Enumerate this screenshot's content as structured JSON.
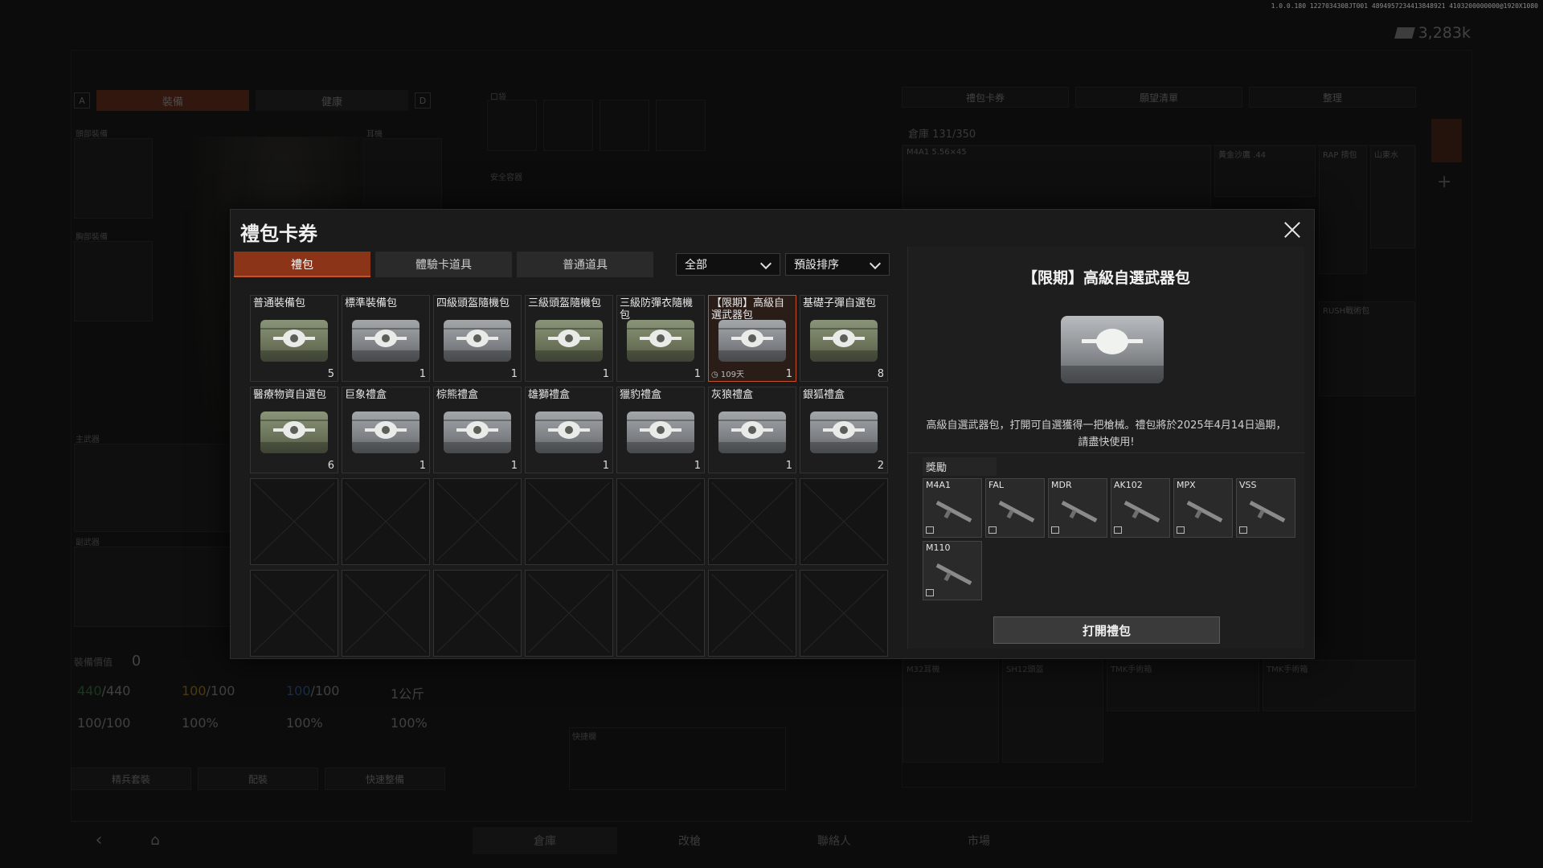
{
  "background": {
    "version": "1.0.0.180 1227034308JT001 4894957234413848921 4103200000000@1920X1080",
    "currency": "3,283k",
    "left_tabs": {
      "key_left": "A",
      "key_right": "D",
      "equip": "裝備",
      "health": "健康"
    },
    "slots": {
      "helmet": "頭部裝備",
      "headset": "耳機",
      "armor": "胸部裝備",
      "pockets": "口袋",
      "secure": "安全容器",
      "primary": "主武器",
      "secondary": "副武器"
    },
    "equip_value_label": "裝備價值",
    "equip_value": "0",
    "stats": {
      "hp": "440",
      "hp_max": "/440",
      "energy": "100",
      "energy_max": "/100",
      "water": "100",
      "water_max": "/100",
      "weight": "1公斤",
      "stamina": "100/100",
      "s2": "100%",
      "s3": "100%",
      "s4": "100%"
    },
    "left_buttons": [
      "精兵套裝",
      "配裝",
      "快速整備"
    ],
    "right_tabs": [
      "禮包卡券",
      "願望清單",
      "整理"
    ],
    "warehouse": "倉庫 131/350",
    "wh_items": [
      "M4A1 5.56×45",
      "黃金沙鷹 .44",
      "RAP 揹包",
      "山東水",
      "RUSH戰術包",
      "M32耳機",
      "SH12頭盔",
      "TMK手術箱",
      "TMK手術箱"
    ],
    "quick_label": "快捷欄",
    "bottom_nav": [
      "倉庫",
      "改槍",
      "聯絡人",
      "市場"
    ]
  },
  "modal": {
    "title": "禮包卡券",
    "tabs": [
      "禮包",
      "體驗卡道具",
      "普通道具"
    ],
    "active_tab": 0,
    "filter": "全部",
    "sort": "預設排序",
    "items": [
      {
        "name": "普通裝備包",
        "count": "5",
        "color": "green"
      },
      {
        "name": "標準裝備包",
        "count": "1",
        "color": "gray"
      },
      {
        "name": "四級頭盔隨機包",
        "count": "1",
        "color": "gray"
      },
      {
        "name": "三級頭盔隨機包",
        "count": "1",
        "color": "green"
      },
      {
        "name": "三級防彈衣隨機包",
        "count": "1",
        "color": "green"
      },
      {
        "name": "【限期】高級自選武器包",
        "count": "1",
        "color": "gray",
        "expiry": "109天",
        "selected": true
      },
      {
        "name": "基礎子彈自選包",
        "count": "8",
        "color": "green"
      },
      {
        "name": "醫療物資自選包",
        "count": "6",
        "color": "green"
      },
      {
        "name": "巨象禮盒",
        "count": "1",
        "color": "gray"
      },
      {
        "name": "棕熊禮盒",
        "count": "1",
        "color": "gray"
      },
      {
        "name": "雄獅禮盒",
        "count": "1",
        "color": "gray"
      },
      {
        "name": "獵豹禮盒",
        "count": "1",
        "color": "gray"
      },
      {
        "name": "灰狼禮盒",
        "count": "1",
        "color": "gray"
      },
      {
        "name": "銀狐禮盒",
        "count": "2",
        "color": "gray"
      }
    ],
    "empty_cells": 14,
    "detail": {
      "title": "【限期】高級自選武器包",
      "description": "高級自選武器包，打開可自選獲得一把槍械。禮包將於2025年4月14日過期，請盡快使用!",
      "reward_label": "獎勵",
      "rewards": [
        "M4A1",
        "FAL",
        "MDR",
        "AK102",
        "MPX",
        "VSS",
        "M110"
      ],
      "open_button": "打開禮包"
    }
  }
}
